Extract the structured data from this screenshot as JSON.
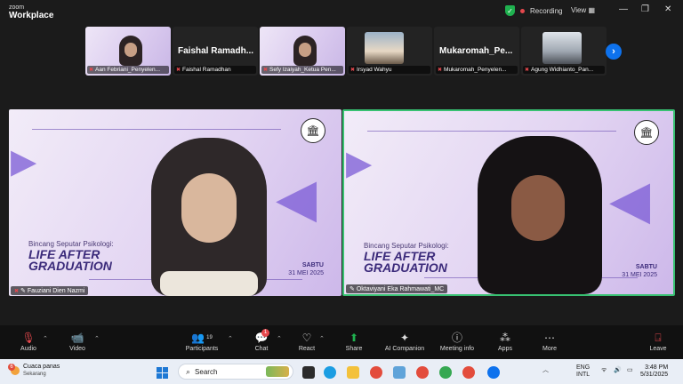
{
  "brand": {
    "line1": "zoom",
    "line2": "Workplace"
  },
  "status": {
    "recording_label": "Recording",
    "view_label": "View"
  },
  "thumbnails": [
    {
      "name": "Aan Febriani_Penyelen...",
      "kind": "video"
    },
    {
      "name": "Faishal Ramadhan",
      "big_name": "Faishal  Ramadh...",
      "kind": "name"
    },
    {
      "name": "Sefy Izaiyah_Ketua Pen...",
      "kind": "video"
    },
    {
      "name": "Irsyad Wahyu",
      "kind": "photo"
    },
    {
      "name": "Mukaromah_Penyelen...",
      "big_name": "Mukaromah_Pe...",
      "kind": "name"
    },
    {
      "name": "Agung Widhianto_Pan...",
      "kind": "photo2"
    }
  ],
  "slide": {
    "subtitle": "Bincang Seputar Psikologi:",
    "title_line1": "LIFE AFTER",
    "title_line2": "GRADUATION",
    "day": "SABTU",
    "date": "31 MEI 2025"
  },
  "main_tiles": [
    {
      "name": "Fauziani Dien Nazmi",
      "active": false
    },
    {
      "name": "Oktaviyani Eka Rahmawati_MC",
      "active": true
    }
  ],
  "toolbar": {
    "audio": "Audio",
    "video": "Video",
    "participants": "Participants",
    "participants_count": "19",
    "chat": "Chat",
    "chat_badge": "1",
    "react": "React",
    "share": "Share",
    "ai_companion": "AI Companion",
    "meeting_info": "Meeting info",
    "apps": "Apps",
    "more": "More",
    "leave": "Leave"
  },
  "taskbar": {
    "weather_title": "Cuaca panas",
    "weather_sub": "Sekarang",
    "weather_badge": "6",
    "search_placeholder": "Search",
    "lang1": "ENG",
    "lang2": "INTL",
    "time": "3:48 PM",
    "date": "5/31/2025"
  },
  "colors": {
    "accent": "#0e72ed",
    "active_border": "#38c172",
    "record": "#e5484d",
    "slide_purple": "#3b2a7a"
  }
}
